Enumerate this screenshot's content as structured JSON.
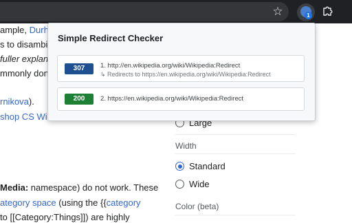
{
  "popup": {
    "title": "Simple Redirect Checker",
    "results": [
      {
        "status": "307",
        "status_color": "#1d4f91",
        "line": "1. http://en.wikipedia.org/wiki/Wikipedia:Redirect",
        "redirect_note": "↳ Redirects to https://en.wikipedia.org/wiki/Wikipedia:Redirect"
      },
      {
        "status": "200",
        "status_color": "#1e8035",
        "line": "2. https://en.wikipedia.org/wiki/Wikipedia:Redirect"
      }
    ]
  },
  "browser": {
    "star_icon": "star-icon",
    "extension_badge": "1",
    "puzzle_icon": "puzzle-icon"
  },
  "wiki": {
    "line1_pre": "ample, ",
    "line1_link": "Durha",
    "line2_pre": "s to disambig",
    "line3": "fuller explan",
    "line4": "mmonly don",
    "line5_link": "rnikova",
    "line5_post": ").",
    "line6_link": "shop CS Wi",
    "line7_bold": "Media:",
    "line7_post": " namespace) do not work. These",
    "line8_link1": "ategory space",
    "line8_mid": " (using the {{",
    "line8_link2": "category",
    "line9": "to [[Category:Things]]) are highly"
  },
  "settings": {
    "large_label": "Large",
    "width_heading": "Width",
    "standard_label": "Standard",
    "wide_label": "Wide",
    "color_heading": "Color (beta)"
  }
}
